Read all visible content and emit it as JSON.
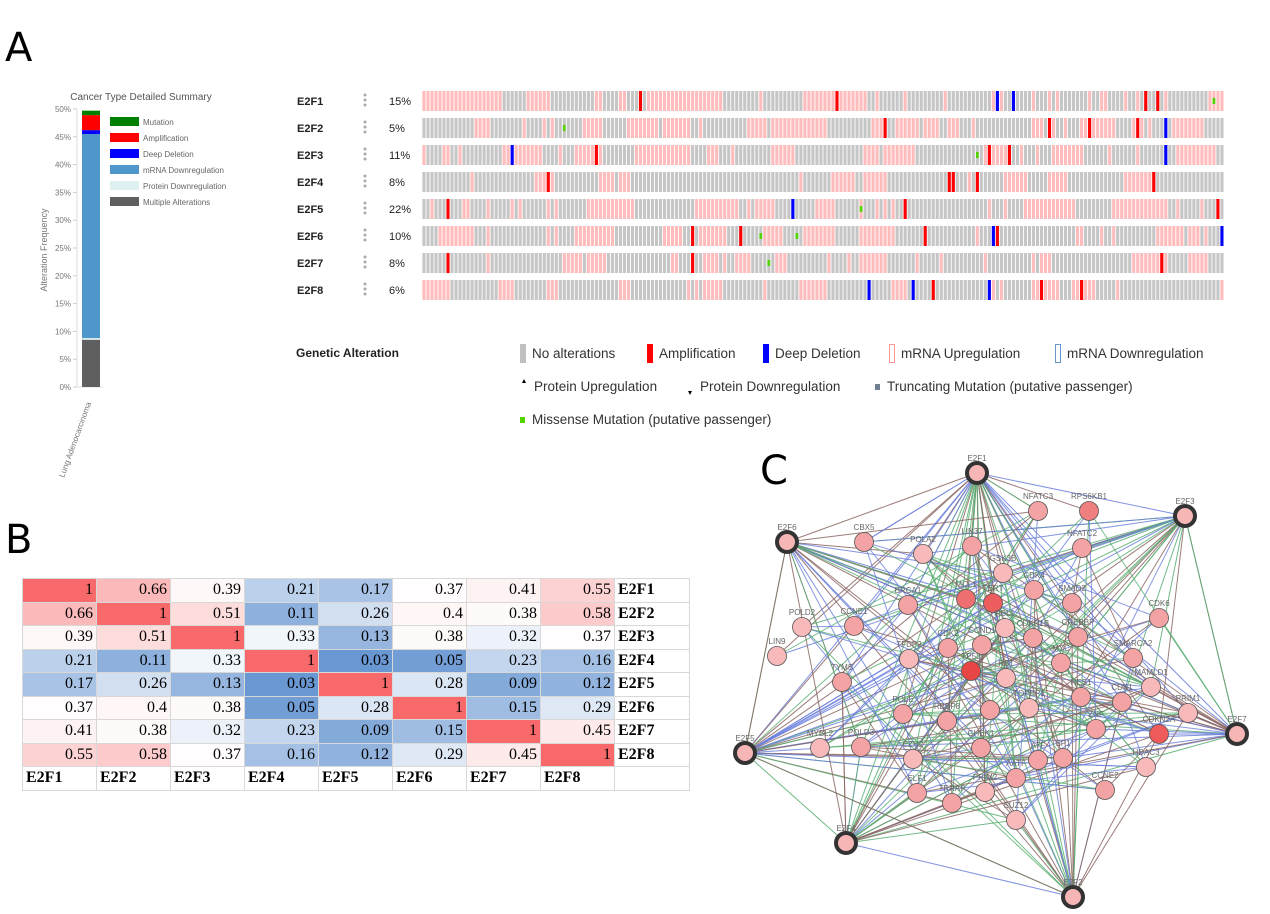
{
  "panel_labels": {
    "a": "A",
    "b": "B",
    "c": "C"
  },
  "chart_data": [
    {
      "type": "bar",
      "stacked": true,
      "title": "Cancer Type Detailed Summary",
      "ylabel": "Alteration Frequency",
      "categories": [
        "Lung Adenocarcinoma"
      ],
      "ylim": [
        0,
        50
      ],
      "yticks": [
        "0%",
        "5%",
        "10%",
        "15%",
        "20%",
        "25%",
        "30%",
        "35%",
        "40%",
        "45%",
        "50%"
      ],
      "legend_position": "right",
      "series": [
        {
          "name": "Multiple Alterations",
          "values": [
            8.5
          ],
          "color": "#5f5f5f"
        },
        {
          "name": "Protein Downregulation",
          "values": [
            0.3
          ],
          "color": "#dff0f0"
        },
        {
          "name": "mRNA Downregulation",
          "values": [
            36.7
          ],
          "color": "#4f97cb"
        },
        {
          "name": "Deep Deletion",
          "values": [
            0.7
          ],
          "color": "#0000ff"
        },
        {
          "name": "Amplification",
          "values": [
            2.7
          ],
          "color": "#ff0000"
        },
        {
          "name": "Mutation",
          "values": [
            0.8
          ],
          "color": "#008000"
        }
      ],
      "legend_order": [
        "Mutation",
        "Amplification",
        "Deep Deletion",
        "mRNA Downregulation",
        "Protein Downregulation",
        "Multiple Alterations"
      ]
    },
    {
      "type": "heatmap",
      "labels": [
        "E2F1",
        "E2F2",
        "E2F3",
        "E2F4",
        "E2F5",
        "E2F6",
        "E2F7",
        "E2F8"
      ],
      "matrix": [
        [
          1,
          0.66,
          0.39,
          0.21,
          0.17,
          0.37,
          0.41,
          0.55
        ],
        [
          0.66,
          1,
          0.51,
          0.11,
          0.26,
          0.4,
          0.38,
          0.58
        ],
        [
          0.39,
          0.51,
          1,
          0.33,
          0.13,
          0.38,
          0.32,
          0.37
        ],
        [
          0.21,
          0.11,
          0.33,
          1,
          0.03,
          0.05,
          0.23,
          0.16
        ],
        [
          0.17,
          0.26,
          0.13,
          0.03,
          1,
          0.28,
          0.09,
          0.12
        ],
        [
          0.37,
          0.4,
          0.38,
          0.05,
          0.28,
          1,
          0.15,
          0.29
        ],
        [
          0.41,
          0.38,
          0.32,
          0.23,
          0.09,
          0.15,
          1,
          0.45
        ],
        [
          0.55,
          0.58,
          0.37,
          0.16,
          0.12,
          0.29,
          0.45,
          1
        ]
      ],
      "colors": {
        "low": "#5b8dce",
        "mid": "#ffffff",
        "high": "#f8696b"
      }
    }
  ],
  "oncoprint": {
    "genes": [
      {
        "name": "E2F1",
        "pct": "15%"
      },
      {
        "name": "E2F2",
        "pct": "5%"
      },
      {
        "name": "E2F3",
        "pct": "11%"
      },
      {
        "name": "E2F4",
        "pct": "8%"
      },
      {
        "name": "E2F5",
        "pct": "22%"
      },
      {
        "name": "E2F6",
        "pct": "10%"
      },
      {
        "name": "E2F7",
        "pct": "8%"
      },
      {
        "name": "E2F8",
        "pct": "6%"
      }
    ],
    "legend_title": "Genetic Alteration",
    "legend": [
      {
        "label": "No alterations",
        "color": "#c0c0c0",
        "kind": "bar"
      },
      {
        "label": "Amplification",
        "color": "#ff0000",
        "kind": "bar"
      },
      {
        "label": "Deep Deletion",
        "color": "#0000ff",
        "kind": "bar"
      },
      {
        "label": "mRNA Upregulation",
        "color": "#ff9999",
        "kind": "outline"
      },
      {
        "label": "mRNA Downregulation",
        "color": "#6699cc",
        "kind": "outline"
      },
      {
        "label": "Protein Upregulation",
        "color": "#000000",
        "kind": "up"
      },
      {
        "label": "Protein Downregulation",
        "color": "#000000",
        "kind": "down"
      },
      {
        "label": "Truncating Mutation (putative passenger)",
        "color": "#708090",
        "kind": "small"
      },
      {
        "label": "Missense Mutation (putative passenger)",
        "color": "#53d400",
        "kind": "small"
      }
    ]
  },
  "network": {
    "edge_colors": [
      "#5aae72",
      "#6b7fdc",
      "#8a6662"
    ],
    "nodes": [
      "E2F1",
      "NFATC3",
      "RPS6KB1",
      "E2F3",
      "E2F6",
      "CBX5",
      "POLA2",
      "LIN37",
      "NFATC2",
      "GSK3B",
      "CDK4",
      "BRCA1",
      "MCL1",
      "TERT",
      "SMAD2",
      "POLD2",
      "CCNE1",
      "CDK6",
      "RBL1",
      "CDKN1B",
      "CREBBP",
      "LIN9",
      "CDK2",
      "CCND1",
      "TFDP2",
      "SMARCA2",
      "TP53",
      "RB1",
      "MYC",
      "TYMS",
      "MAMLD1",
      "HES1",
      "CDK1",
      "PRIM1",
      "POLE",
      "RBBP8",
      "TOPBP1",
      "",
      "ZNF",
      "CDKN2A",
      "E2F7",
      "E2F5",
      "MYBL2",
      "POLD3",
      "CHEK1",
      "EZH2",
      "ATF",
      "SP1",
      "HDAC3",
      "AATF",
      "ELF1",
      "PRIM2",
      "CCNE2",
      "TRRAP",
      "SUZ12",
      "E2F4",
      "E2F2"
    ]
  }
}
